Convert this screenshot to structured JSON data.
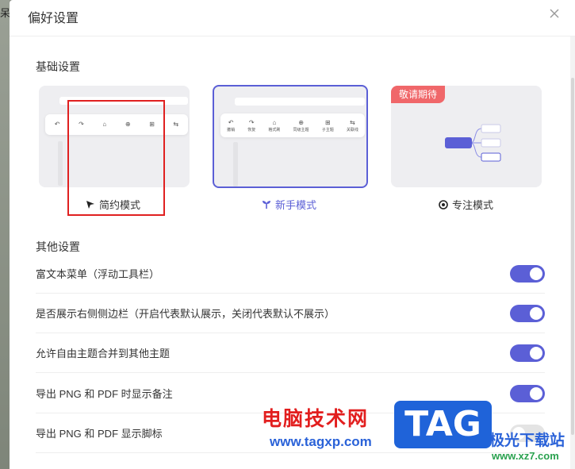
{
  "background": {
    "left_fragment": "呆"
  },
  "dialog": {
    "title": "偏好设置"
  },
  "basic": {
    "title": "基础设置",
    "modes": [
      {
        "label": "简约模式",
        "icon": "cursor-arrow-icon",
        "selected": false,
        "highlighted_in_red": true
      },
      {
        "label": "新手模式",
        "icon": "sprout-icon",
        "selected": true
      },
      {
        "label": "专注模式",
        "icon": "target-icon",
        "selected": false,
        "badge": "敬请期待"
      }
    ]
  },
  "other": {
    "title": "其他设置",
    "settings": [
      {
        "label": "富文本菜单（浮动工具栏）",
        "enabled": true
      },
      {
        "label": "是否展示右侧侧边栏（开启代表默认展示，关闭代表默认不展示）",
        "enabled": true
      },
      {
        "label": "允许自由主题合并到其他主题",
        "enabled": true
      },
      {
        "label": "导出 PNG 和 PDF 时显示备注",
        "enabled": true
      },
      {
        "label": "导出 PNG 和 PDF 显示脚标",
        "enabled": false
      }
    ]
  },
  "watermark": {
    "title": "电脑技术网",
    "url": "www.tagxp.com",
    "logo": "TAG",
    "site2": "极光下载站",
    "url2": "www.xz7.com"
  },
  "colors": {
    "accent": "#5b5fd6",
    "badge": "#f0676a",
    "highlight": "#e02020"
  }
}
